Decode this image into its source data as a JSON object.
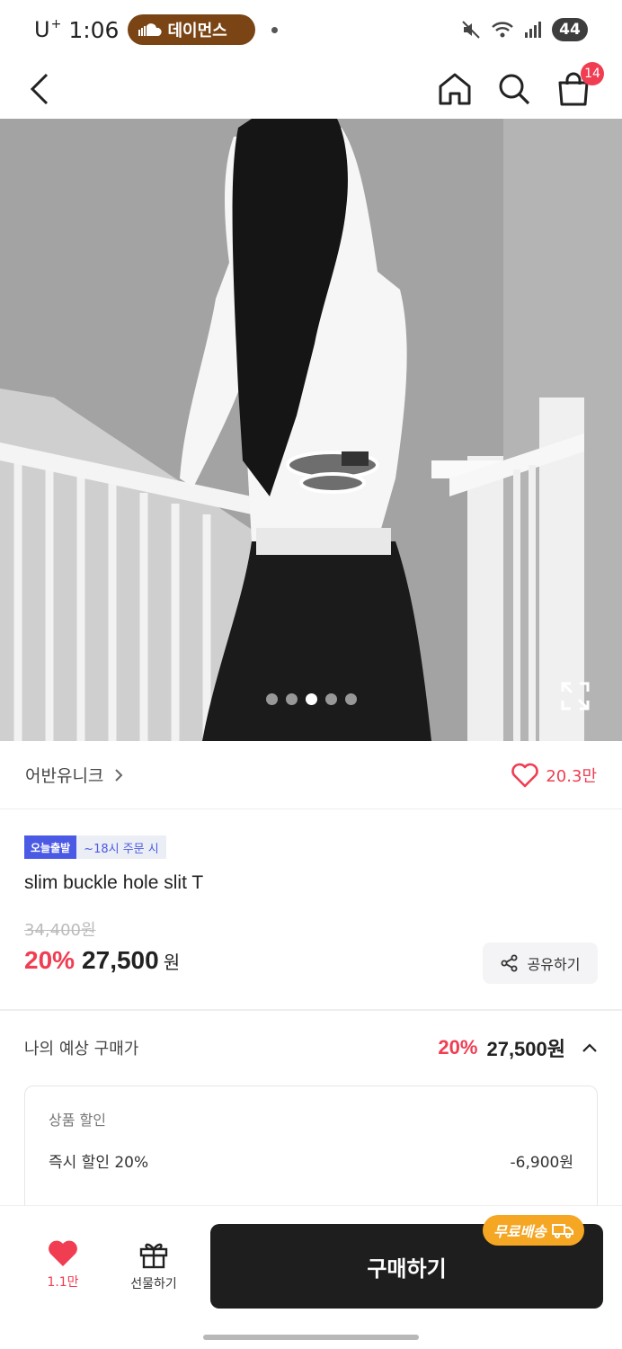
{
  "status_bar": {
    "carrier": "U",
    "carrier_sup": "+",
    "time": "1:06",
    "media_app": "데이먼스",
    "battery": "44"
  },
  "nav": {
    "cart_count": "14"
  },
  "gallery": {
    "dot_count": 5,
    "active_index": 2
  },
  "brand": {
    "name": "어반유니크",
    "likes": "20.3만"
  },
  "product": {
    "badge_today": "오늘출발",
    "badge_time": "~18시 주문 시",
    "title": "slim buckle hole slit T",
    "original_price": "34,400원",
    "discount": "20%",
    "price": "27,500",
    "currency": "원",
    "share_label": "공유하기"
  },
  "expected": {
    "label": "나의 예상 구매가",
    "discount": "20%",
    "price": "27,500원",
    "card_title": "상품 할인",
    "line_label": "즉시 할인 20%",
    "line_amount": "-6,900원"
  },
  "bottom": {
    "like_count": "1.1만",
    "gift_label": "선물하기",
    "buy_label": "구매하기",
    "free_shipping": "무료배송"
  },
  "colors": {
    "accent": "#f03d52",
    "badge_blue": "#4b5ae4",
    "free_ship": "#f5a623",
    "buy_button": "#1e1e1e"
  }
}
